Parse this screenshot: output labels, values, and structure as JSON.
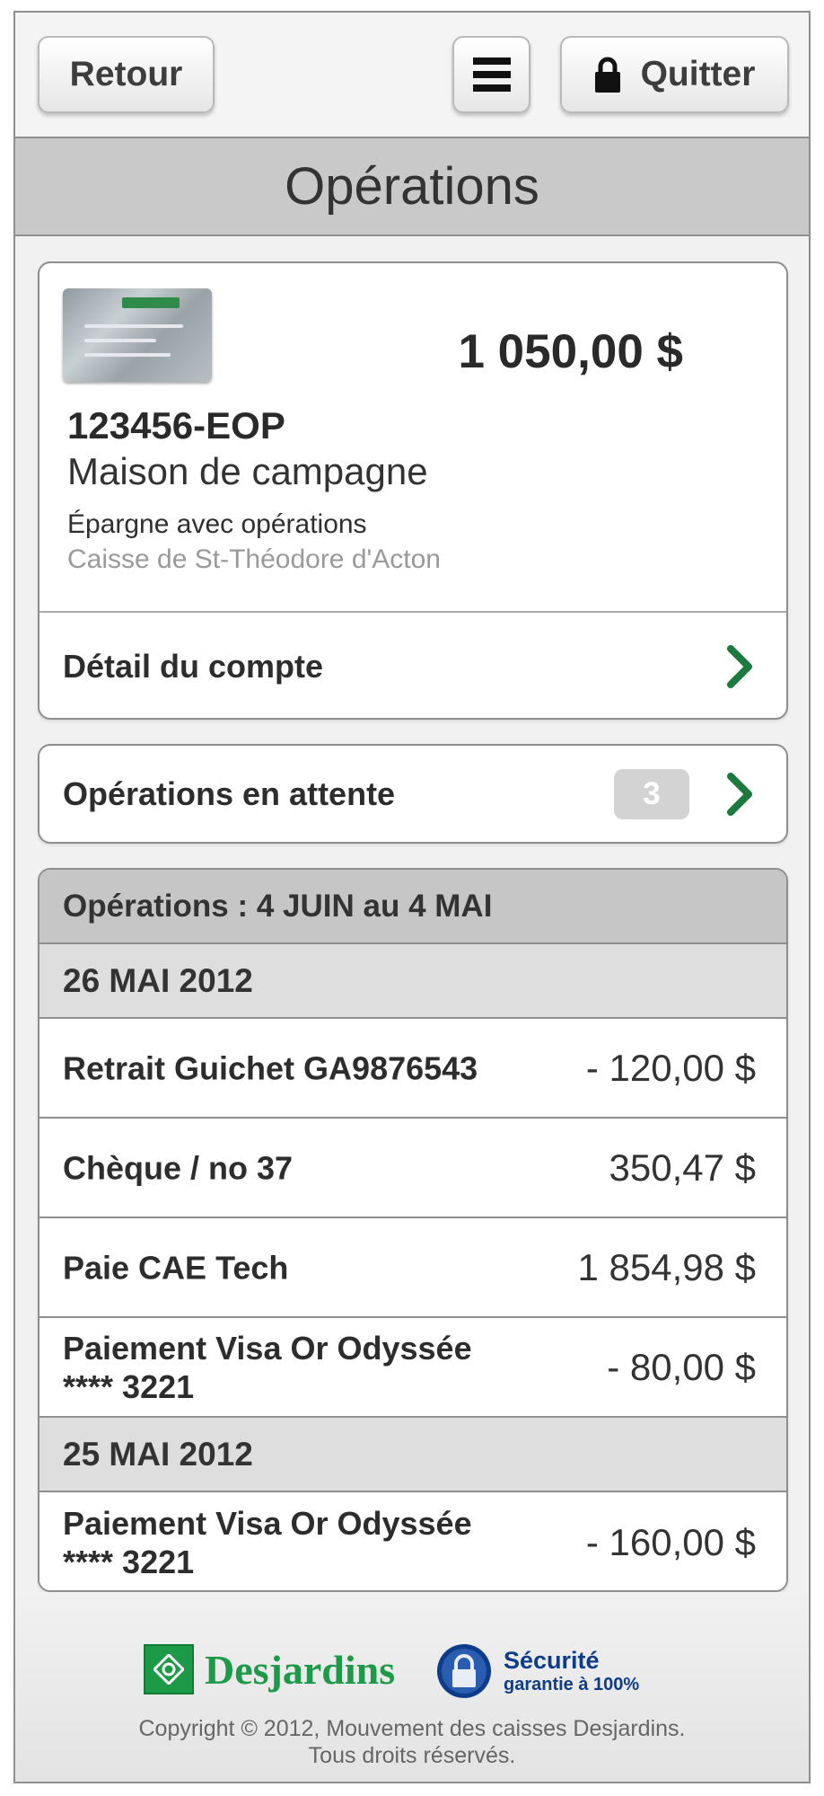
{
  "topbar": {
    "back_label": "Retour",
    "menu_icon": "hamburger-menu-icon",
    "quit_label": "Quitter",
    "quit_icon": "lock-icon"
  },
  "title": "Opérations",
  "account": {
    "card_icon": "desjardins-card-image",
    "balance": "1 050,00 $",
    "number": "123456-EOP",
    "name": "Maison de campagne",
    "type": "Épargne avec opérations",
    "branch": "Caisse de St-Théodore d'Acton",
    "detail_label": "Détail du compte"
  },
  "pending": {
    "label": "Opérations en attente",
    "count": "3"
  },
  "operations": {
    "header": "Opérations : 4 JUIN au 4 MAI",
    "groups": [
      {
        "date": "26 MAI 2012",
        "items": [
          {
            "label": "Retrait Guichet GA9876543",
            "amount": "- 120,00 $"
          },
          {
            "label": "Chèque / no 37",
            "amount": "350,47 $"
          },
          {
            "label": "Paie CAE Tech",
            "amount": "1 854,98 $"
          },
          {
            "label": "Paiement Visa Or Odyssée\n**** 3221",
            "amount": "- 80,00 $"
          }
        ]
      },
      {
        "date": "25 MAI 2012",
        "items": [
          {
            "label": "Paiement Visa Or Odyssée\n**** 3221",
            "amount": "- 160,00 $"
          }
        ]
      }
    ]
  },
  "footer": {
    "brand": "Desjardins",
    "security_title": "Sécurité",
    "security_subtitle": "garantie à 100%",
    "copyright_line1": "Copyright © 2012, Mouvement des caisses Desjardins.",
    "copyright_line2": "Tous droits réservés."
  },
  "colors": {
    "accent_green": "#1d7a3e",
    "brand_green": "#1d9a47",
    "security_blue": "#0d3c8a",
    "title_bar": "#c9c9c9"
  }
}
